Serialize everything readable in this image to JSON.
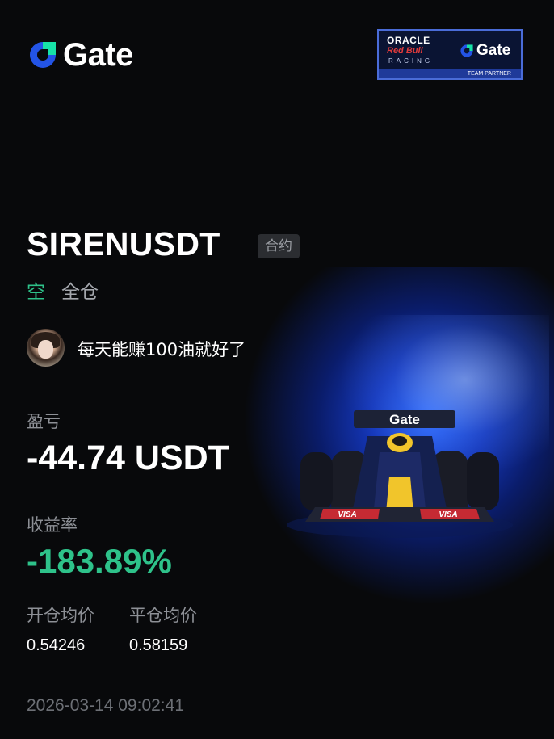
{
  "brand": {
    "logo_text": "Gate"
  },
  "partner": {
    "line1": "ORACLE",
    "line2": "Red Bull",
    "line3": "RACING",
    "gate_text": "Gate",
    "footer": "TEAM PARTNER"
  },
  "position": {
    "symbol": "SIRENUSDT",
    "badge": "合约",
    "side": "空",
    "margin_mode": "全仓"
  },
  "user": {
    "nickname": "每天能赚100油就好了"
  },
  "pnl": {
    "label": "盈亏",
    "value": "-44.74 USDT"
  },
  "roi": {
    "label": "收益率",
    "value": "-183.89%"
  },
  "prices": {
    "open_label": "开仓均价",
    "open_value": "0.54246",
    "close_label": "平仓均价",
    "close_value": "0.58159"
  },
  "timestamp": "2026-03-14 09:02:41",
  "car": {
    "wing_text": "Gate",
    "sidepod_text": "VISA"
  },
  "colors": {
    "background": "#08090b",
    "accent_green": "#2ec28a",
    "brand_blue": "#2354e6",
    "brand_green": "#17e2a7"
  }
}
